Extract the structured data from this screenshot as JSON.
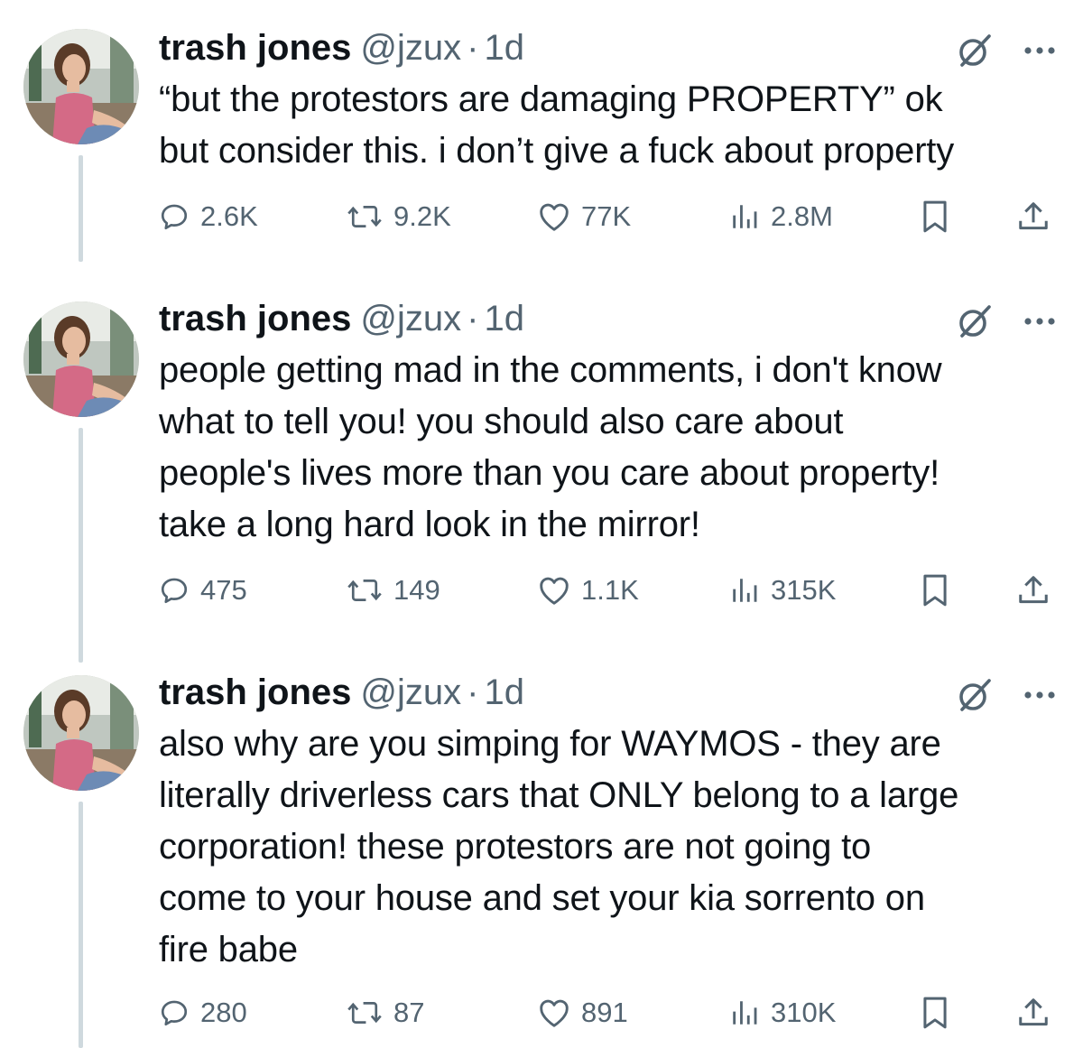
{
  "tweets": [
    {
      "author": {
        "name": "trash jones",
        "handle": "@jzux",
        "separator": "·",
        "time": "1d"
      },
      "lines": [
        "“but the protestors are damaging PROPERTY” ok",
        "but consider this. i don’t give a fuck about property"
      ],
      "stats": {
        "replies": "2.6K",
        "retweets": "9.2K",
        "likes": "77K",
        "views": "2.8M"
      }
    },
    {
      "author": {
        "name": "trash jones",
        "handle": "@jzux",
        "separator": "·",
        "time": "1d"
      },
      "lines": [
        "people getting mad in the comments, i don't know",
        "what to tell you! you should also care about",
        "people's lives more than you care about property!",
        "take a long hard look in the mirror!"
      ],
      "stats": {
        "replies": "475",
        "retweets": "149",
        "likes": "1.1K",
        "views": "315K"
      }
    },
    {
      "author": {
        "name": "trash jones",
        "handle": "@jzux",
        "separator": "·",
        "time": "1d"
      },
      "lines": [
        "also why are you simping for WAYMOS - they are",
        "literally driverless cars that ONLY belong to a large",
        "corporation! these protestors are not going to",
        "come to your house and set your kia sorrento on",
        "fire babe"
      ],
      "stats": {
        "replies": "280",
        "retweets": "87",
        "likes": "891",
        "views": "310K"
      }
    }
  ],
  "icons": {
    "header": [
      "grok-icon",
      "more-icon"
    ],
    "actions": [
      "reply-icon",
      "retweet-icon",
      "like-icon",
      "views-icon",
      "bookmark-icon",
      "share-icon"
    ]
  },
  "colors": {
    "text": "#0f1419",
    "secondary": "#536471",
    "thread_line": "#cfd9de",
    "background": "#ffffff"
  }
}
